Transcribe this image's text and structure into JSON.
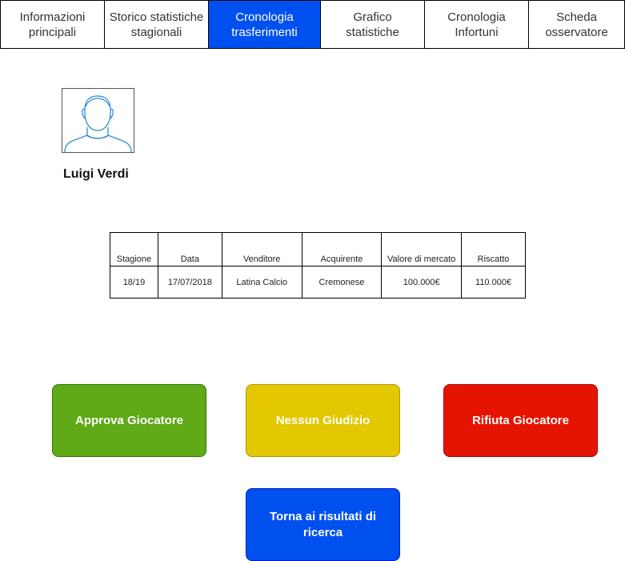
{
  "tabs": [
    {
      "label": "Informazioni\nprincipali"
    },
    {
      "label": "Storico statistiche\nstagionali"
    },
    {
      "label": "Cronologia\ntrasferimenti"
    },
    {
      "label": "Grafico\nstatistiche"
    },
    {
      "label": "Cronologia\nInfortuni"
    },
    {
      "label": "Scheda\nosservatore"
    }
  ],
  "active_tab": "Cronologia\ntrasferimenti",
  "player": {
    "name": "Luigi Verdi",
    "avatar_icon": "user-avatar-icon"
  },
  "transfers": {
    "headers": [
      "Stagione",
      "Data",
      "Venditore",
      "Acquirente",
      "Valore di mercato",
      "Riscatto"
    ],
    "rows": [
      [
        "18/19",
        "17/07/2018",
        "Latina Calcio",
        "Cremonese",
        "100.000€",
        "110.000€"
      ]
    ]
  },
  "actions": {
    "approve_label": "Approva Giocatore",
    "neutral_label": "Nessun Giudizio",
    "reject_label": "Rifiuta Giocatore",
    "back_label": "Torna ai risultati di ricerca"
  },
  "colors": {
    "active_tab": "#0050ef",
    "approve": "#60a917",
    "neutral": "#e3c800",
    "reject": "#e51400",
    "back": "#0050ef",
    "avatar_stroke": "#2f8fd8"
  }
}
